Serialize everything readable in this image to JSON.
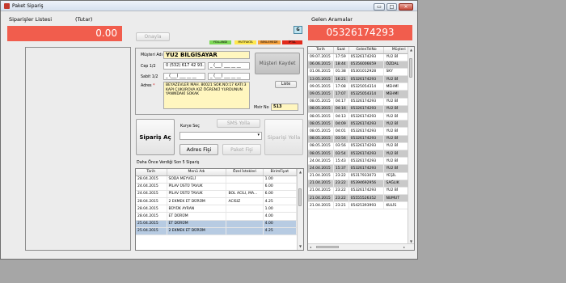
{
  "window": {
    "title": "Paket Sipariş",
    "min": "▭",
    "max": "□",
    "close": "×"
  },
  "orders": {
    "label": "Siparişler Listesi",
    "sublabel": "(Tutar)",
    "total": "0.00",
    "approve_button": "Onayla"
  },
  "calls": {
    "label": "Gelen Aramalar",
    "number": "05326174293"
  },
  "g_button": "G",
  "legend": [
    {
      "label": "YOLLANDI",
      "color": "#7ed957"
    },
    {
      "label": "MUTFAKTA",
      "color": "#ffe84d"
    },
    {
      "label": "BEKLEMEDE",
      "color": "#f6a13c"
    },
    {
      "label": "İPTAL",
      "color": "#e22a1b"
    }
  ],
  "customer": {
    "name_label": "Müşteri Adı",
    "name": "YU2 BİLGİSAYAR",
    "mobile_label": "Cep 1/2",
    "mobile1": "0 (532) 617 42 93.",
    "mobile2": "_ (___) ___ __ __",
    "fixed_label": "Sabit 1/2",
    "fixed1": "_ (___) ___ __ __",
    "fixed2": "_ (___) ___ __ __",
    "address_label": "Adres",
    "required_mark": "*",
    "address": "BEYAZEVLER MAH. 80021 SOK.NO:17 KATI:3 KAPI ÇUKUROVA KIZ ÖĞRENCİ YURDUNUN YANINDAKİ SOKAK",
    "save_button": "Müşteri Kaydet",
    "late_button": "Liste",
    "customer_no_label": "Mstr No",
    "customer_no": "513"
  },
  "actions": {
    "order_open": "Sipariş Aç",
    "courier_label": "Kurye Seç",
    "sms_button": "SMS Yolla",
    "send_order": "Siparişi Yolla",
    "address_slip": "Adres Fişi",
    "package_slip": "Paket Fişi"
  },
  "recent": {
    "label": "Daha Önce Verdiği Son 5 Sipariş",
    "headers": [
      "Tarih",
      "Menü Adı",
      "Özel İstekleri",
      "BirimFiyat"
    ],
    "rows": [
      [
        "28.04.2015",
        "SODA MEYVELİ",
        "",
        "1.00"
      ],
      [
        "24.04.2015",
        "PİLAV ÜSTÜ TAVUK",
        "",
        "6.00"
      ],
      [
        "24.04.2015",
        "PİLAV ÜSTÜ TAVUK",
        "BOL ACILI, MA...",
        "6.00"
      ],
      [
        "28.04.2015",
        "2 EKMEK ET DÜRÜM",
        "ACISIZ",
        "4.25"
      ],
      [
        "28.04.2015",
        "BÜYÜK AYRAN",
        "",
        "1.00"
      ],
      [
        "28.04.2015",
        "ET DÜRÜM",
        "",
        "4.00"
      ],
      [
        "25.04.2015",
        "ET DÜRÜM",
        "",
        "4.00"
      ],
      [
        "25.04.2015",
        "2 EKMEK ET DÜRÜM",
        "",
        "4.25"
      ]
    ]
  },
  "calls_table": {
    "headers": [
      "Tarih",
      "Saat",
      "GelenTelNo",
      "Müşteri"
    ],
    "rows": [
      [
        "09.07.2015",
        "17:59",
        "05326174293",
        "YU2 Bİ"
      ],
      [
        "06.06.2015",
        "18:44",
        "05356006659",
        "ÖZDAL"
      ],
      [
        "01.06.2015",
        "01:38",
        "05301012928",
        "SKY"
      ],
      [
        "13.05.2015",
        "16:21",
        "05326174293",
        "YU2 Bİ"
      ],
      [
        "09.05.2015",
        "17:08",
        "05325054314",
        "MEHMİ"
      ],
      [
        "09.05.2015",
        "17:07",
        "05325054314",
        "MEHMİ"
      ],
      [
        "08.05.2015",
        "04:17",
        "05326174293",
        "YU2 Bİ"
      ],
      [
        "08.05.2015",
        "04:16",
        "05326174293",
        "YU2 Bİ"
      ],
      [
        "08.05.2015",
        "04:13",
        "05326174293",
        "YU2 Bİ"
      ],
      [
        "08.05.2015",
        "04:09",
        "05326174293",
        "YU2 Bİ"
      ],
      [
        "08.05.2015",
        "04:01",
        "05326174293",
        "YU2 Bİ"
      ],
      [
        "08.05.2015",
        "03:56",
        "05326174293",
        "YU2 Bİ"
      ],
      [
        "08.05.2015",
        "03:56",
        "05326174293",
        "YU2 Bİ"
      ],
      [
        "08.05.2015",
        "03:54",
        "05326174293",
        "YU2 Bİ"
      ],
      [
        "24.04.2015",
        "15:43",
        "05326174293",
        "YU2 Bİ"
      ],
      [
        "24.04.2015",
        "15:37",
        "05326174293",
        "YU2 Bİ"
      ],
      [
        "21.04.2015",
        "23:22",
        "05317933073",
        "YEŞİL"
      ],
      [
        "21.04.2015",
        "23:22",
        "05394692956",
        "SAĞLIK"
      ],
      [
        "21.04.2015",
        "23:22",
        "05326174293",
        "YU2 Bİ"
      ],
      [
        "21.04.2015",
        "23:22",
        "05555526352",
        "NUMUT"
      ],
      [
        "21.04.2015",
        "23:21",
        "05425393993",
        "KULİS"
      ]
    ]
  }
}
